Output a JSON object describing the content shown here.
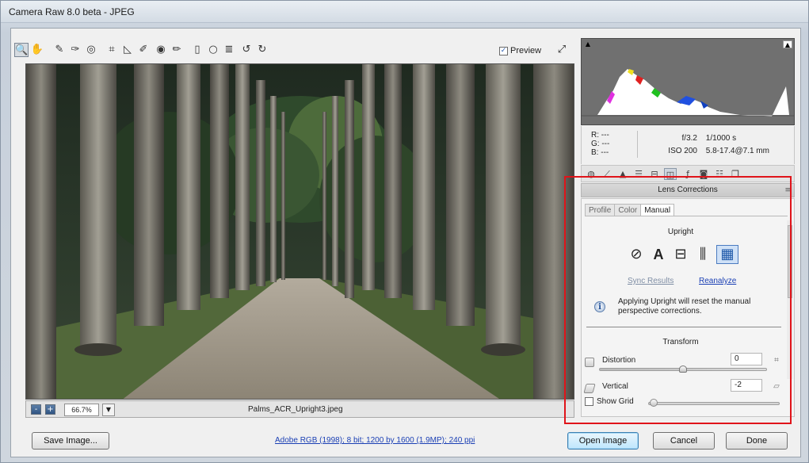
{
  "window": {
    "title": "Camera Raw 8.0 beta  -  JPEG"
  },
  "toolbar": {
    "tools": [
      {
        "name": "zoom-tool",
        "glyph": "🔍"
      },
      {
        "name": "hand-tool",
        "glyph": "✋"
      },
      {
        "name": "white-balance-tool",
        "glyph": "✎"
      },
      {
        "name": "color-sampler-tool",
        "glyph": "✑"
      },
      {
        "name": "targeted-adjustment-tool",
        "glyph": "◎"
      },
      {
        "name": "crop-tool",
        "glyph": "⌗"
      },
      {
        "name": "straighten-tool",
        "glyph": "◺"
      },
      {
        "name": "spot-removal-tool",
        "glyph": "✐"
      },
      {
        "name": "red-eye-tool",
        "glyph": "◉"
      },
      {
        "name": "adjustment-brush-tool",
        "glyph": "✏"
      },
      {
        "name": "graduated-filter-tool",
        "glyph": "▯"
      },
      {
        "name": "radial-filter-tool",
        "glyph": "○"
      },
      {
        "name": "preferences-tool",
        "glyph": "≣"
      },
      {
        "name": "rotate-ccw-tool",
        "glyph": "↺"
      },
      {
        "name": "rotate-cw-tool",
        "glyph": "↻"
      }
    ],
    "preview_label": "Preview",
    "preview_checked": "✓"
  },
  "statusbar": {
    "zoom_out": "-",
    "zoom_in": "+",
    "zoom_value": "66.7%",
    "zoom_dropdown": "▼",
    "filename": "Palms_ACR_Upright3.jpeg"
  },
  "info": {
    "r_label": "R:",
    "r_value": "---",
    "g_label": "G:",
    "g_value": "---",
    "b_label": "B:",
    "b_value": "---",
    "aperture": "f/3.2",
    "shutter": "1/1000 s",
    "iso": "ISO 200",
    "lens": "5.8-17.4@7.1 mm"
  },
  "panel": {
    "title": "Lens Corrections",
    "subtabs": [
      "Profile",
      "Color",
      "Manual"
    ],
    "active_subtab": "Manual",
    "upright": {
      "title": "Upright",
      "options": [
        {
          "name": "upright-off-icon",
          "glyph": "⊘"
        },
        {
          "name": "upright-auto-icon",
          "glyph": "A"
        },
        {
          "name": "upright-level-icon",
          "glyph": "⊟"
        },
        {
          "name": "upright-vertical-icon",
          "glyph": "⫼"
        },
        {
          "name": "upright-full-icon",
          "glyph": "▦"
        }
      ],
      "selected": "upright-full-icon",
      "sync_results": "Sync Results",
      "reanalyze": "Reanalyze",
      "info_text": "Applying Upright will reset the manual perspective corrections."
    },
    "transform": {
      "title": "Transform",
      "sliders": [
        {
          "label": "Distortion",
          "value": "0",
          "position": 0.5
        },
        {
          "label": "Vertical",
          "value": "-2",
          "position": 0.49
        }
      ]
    },
    "show_grid_label": "Show Grid"
  },
  "footer": {
    "save_image": "Save Image...",
    "workflow": "Adobe RGB (1998); 8 bit; 1200 by 1600 (1.9MP); 240 ppi",
    "open_image": "Open Image",
    "cancel": "Cancel",
    "done": "Done"
  }
}
